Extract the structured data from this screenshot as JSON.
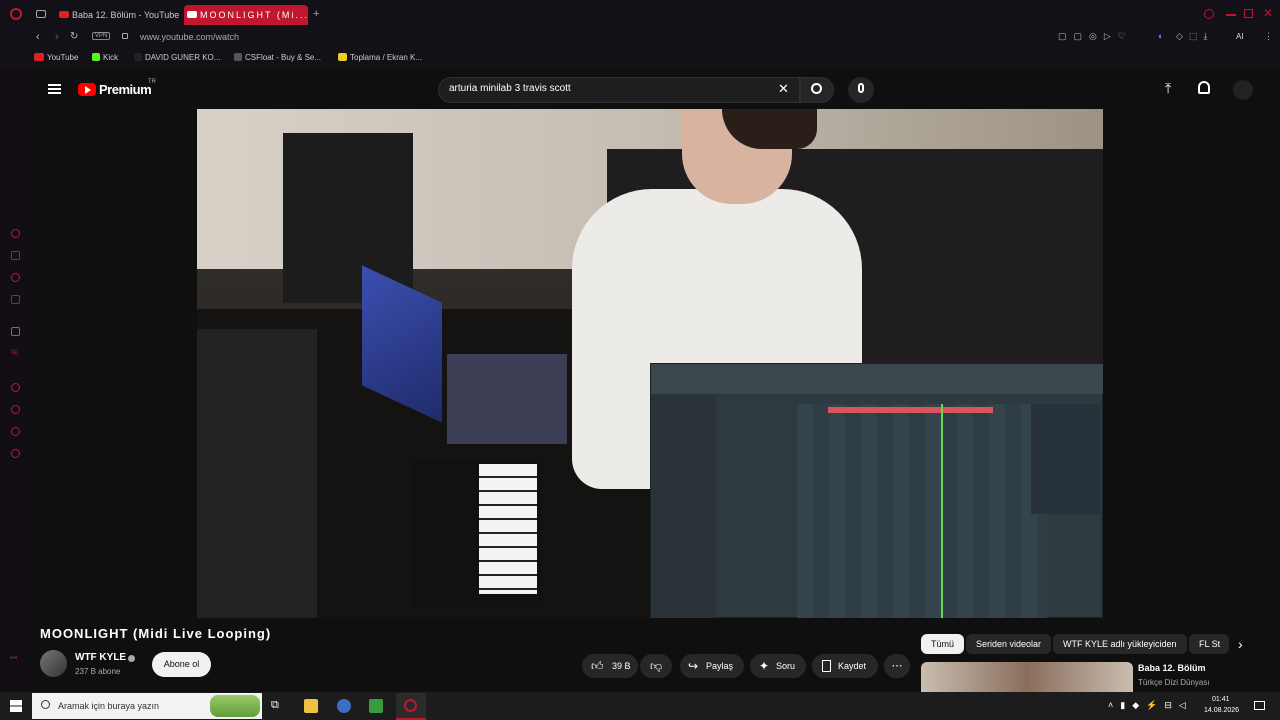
{
  "browser": {
    "tabs": [
      {
        "label": "Baba 12. Bölüm - YouTube"
      },
      {
        "label": "MOONLIGHT (Mi..."
      }
    ],
    "url": "www.youtube.com/watch",
    "vpn_label": "VPN",
    "ai_label": "AI",
    "bookmarks": [
      {
        "label": "YouTube",
        "color": "#e02020"
      },
      {
        "label": "Kick",
        "color": "#53fc18"
      },
      {
        "label": "DAVID GUNER KO...",
        "color": "#333333"
      },
      {
        "label": "CSFloat - Buy & Se...",
        "color": "#555555"
      },
      {
        "label": "Toplama / Ekran K...",
        "color": "#e8d020"
      }
    ]
  },
  "youtube": {
    "logo_text": "Premium",
    "logo_badge": "TR",
    "search_value": "arturia minilab 3 travis scott",
    "video_title": "MOONLIGHT (Midi Live Looping)",
    "channel": "WTF KYLE",
    "subscribers": "237 B abone",
    "subscribe_label": "Abone ol",
    "likes": "39 B",
    "share_label": "Paylaş",
    "ask_label": "Soru",
    "save_label": "Kaydet",
    "chips": [
      "Tümü",
      "Seriden videolar",
      "WTF KYLE adlı yükleyiciden",
      "FL St"
    ],
    "next_video": {
      "title": "Baba 12. Bölüm",
      "channel": "Türkçe Dizi Dünyası"
    }
  },
  "taskbar": {
    "search_placeholder": "Aramak için buraya yazın",
    "time": "01:41",
    "date": "14.08.2026"
  },
  "colors": {
    "accent": "#c0162e",
    "youtube_red": "#ff0000"
  }
}
